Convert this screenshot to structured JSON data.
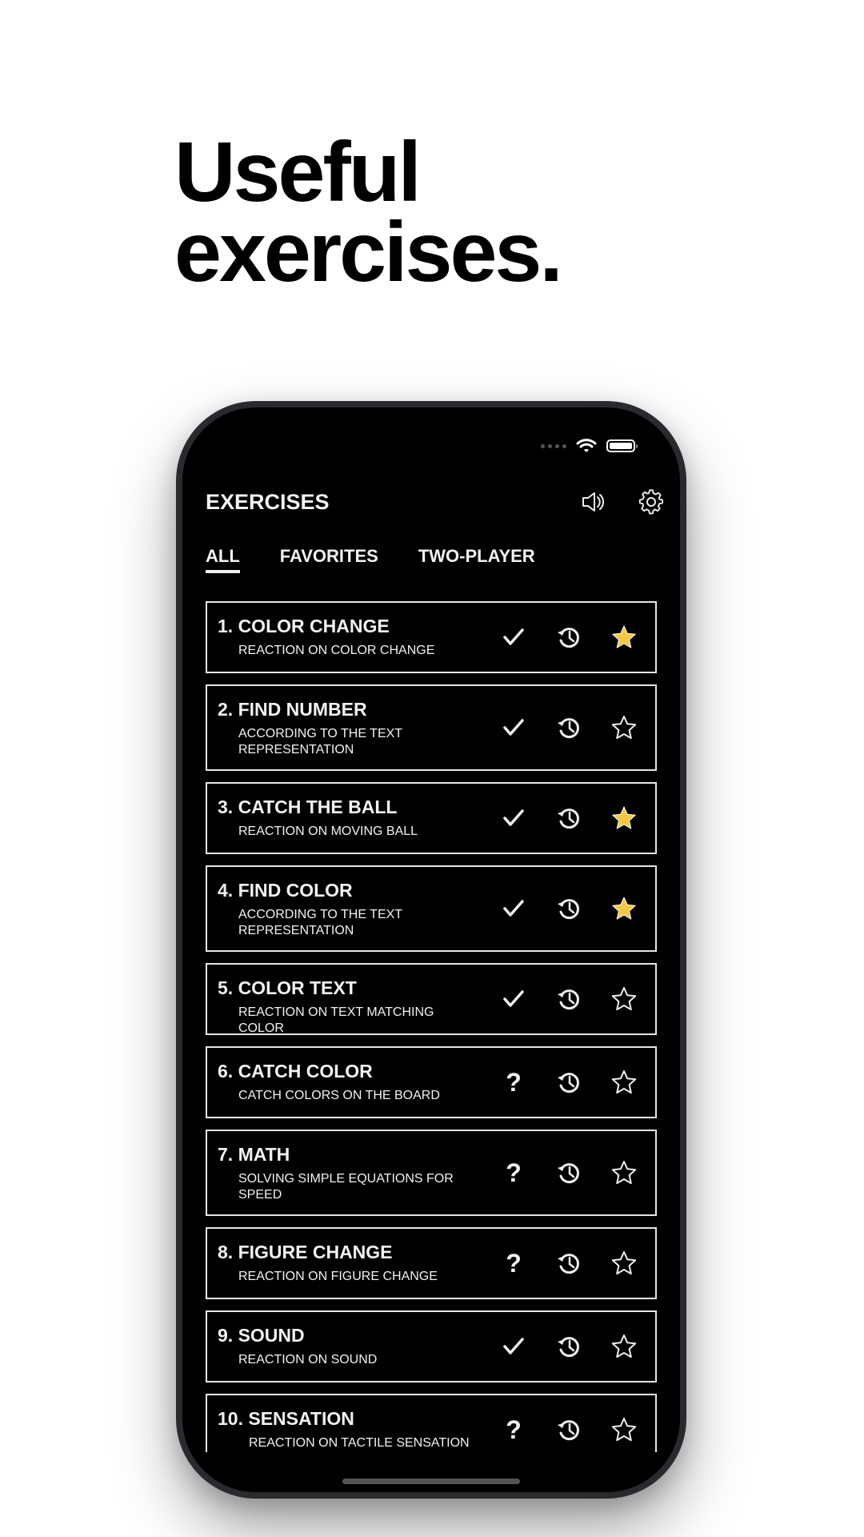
{
  "headline": {
    "line1": "Useful",
    "line2": "exercises."
  },
  "app": {
    "title": "EXERCISES",
    "header_icons": [
      "speaker-icon",
      "gear-icon"
    ],
    "tabs": [
      {
        "label": "ALL",
        "active": true
      },
      {
        "label": "FAVORITES",
        "active": false
      },
      {
        "label": "TWO-PLAYER",
        "active": false
      }
    ],
    "accent_star_color": "#f5c842",
    "exercises": [
      {
        "name": "1. COLOR CHANGE",
        "desc": "REACTION ON COLOR CHANGE",
        "status": "check",
        "favorite": true
      },
      {
        "name": "2. FIND NUMBER",
        "desc": "ACCORDING TO THE TEXT REPRESENTATION",
        "status": "check",
        "favorite": false
      },
      {
        "name": "3. CATCH THE BALL",
        "desc": "REACTION ON MOVING BALL",
        "status": "check",
        "favorite": true
      },
      {
        "name": "4. FIND COLOR",
        "desc": "ACCORDING TO THE TEXT REPRESENTATION",
        "status": "check",
        "favorite": true
      },
      {
        "name": "5. COLOR TEXT",
        "desc": "REACTION ON TEXT MATCHING COLOR",
        "status": "check",
        "favorite": false
      },
      {
        "name": "6. CATCH COLOR",
        "desc": "CATCH COLORS ON THE BOARD",
        "status": "question",
        "favorite": false
      },
      {
        "name": "7. MATH",
        "desc": "SOLVING SIMPLE EQUATIONS FOR SPEED",
        "status": "question",
        "favorite": false
      },
      {
        "name": "8. FIGURE CHANGE",
        "desc": "REACTION ON FIGURE CHANGE",
        "status": "question",
        "favorite": false
      },
      {
        "name": "9. SOUND",
        "desc": "REACTION ON SOUND",
        "status": "check",
        "favorite": false
      },
      {
        "name": "10. SENSATION",
        "desc": "REACTION ON TACTILE SENSATION",
        "status": "question",
        "favorite": false
      }
    ]
  }
}
